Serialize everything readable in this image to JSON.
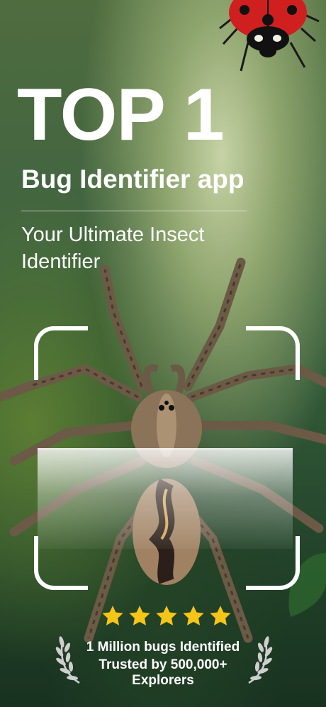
{
  "headline": "TOP 1",
  "subhead": "Bug Identifier app",
  "tagline": "Your Ultimate Insect Identifier",
  "rating": {
    "stars": 5,
    "star_color": "#f5c518"
  },
  "stats": {
    "line1": "1 Million bugs Identified",
    "line2": "Trusted by 500,000+",
    "line3": "Explorers"
  },
  "icons": [
    "ladybug-image",
    "spider-image",
    "star-icon",
    "laurel-icon"
  ]
}
